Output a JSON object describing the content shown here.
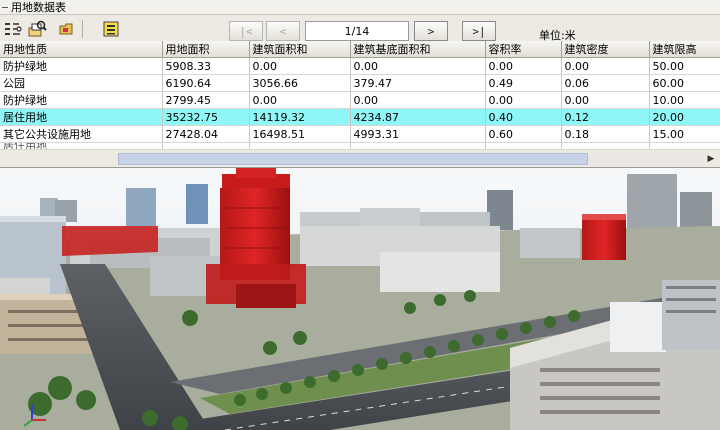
{
  "window": {
    "title": "用地数据表"
  },
  "toolbar": {
    "icons": [
      "table-settings-icon",
      "zoom-layer-icon",
      "folder-icon",
      "export-icon"
    ]
  },
  "pager": {
    "first": "|<",
    "prev": "<",
    "page": "1/14",
    "next": ">",
    "last": ">|",
    "unit": "单位:米"
  },
  "table": {
    "columns": [
      "用地性质",
      "用地面积",
      "建筑面积和",
      "建筑基底面积和",
      "容积率",
      "建筑密度",
      "建筑限高"
    ],
    "rows": [
      [
        "防护绿地",
        "5908.33",
        "0.00",
        "0.00",
        "0.00",
        "0.00",
        "50.00"
      ],
      [
        "公园",
        "6190.64",
        "3056.66",
        "379.47",
        "0.49",
        "0.06",
        "60.00"
      ],
      [
        "防护绿地",
        "2799.45",
        "0.00",
        "0.00",
        "0.00",
        "0.00",
        "10.00"
      ],
      [
        "居住用地",
        "35232.75",
        "14119.32",
        "4234.87",
        "0.40",
        "0.12",
        "20.00"
      ],
      [
        "其它公共设施用地",
        "27428.04",
        "16498.51",
        "4993.31",
        "0.60",
        "0.18",
        "15.00"
      ],
      [
        "居住用地",
        "",
        "",
        "",
        "",
        "",
        ""
      ]
    ],
    "selected_row": 3
  },
  "colors": {
    "selection": "#8ff7f7",
    "highlight_building": "#d41f1f",
    "sky": "#f4f6f8"
  }
}
